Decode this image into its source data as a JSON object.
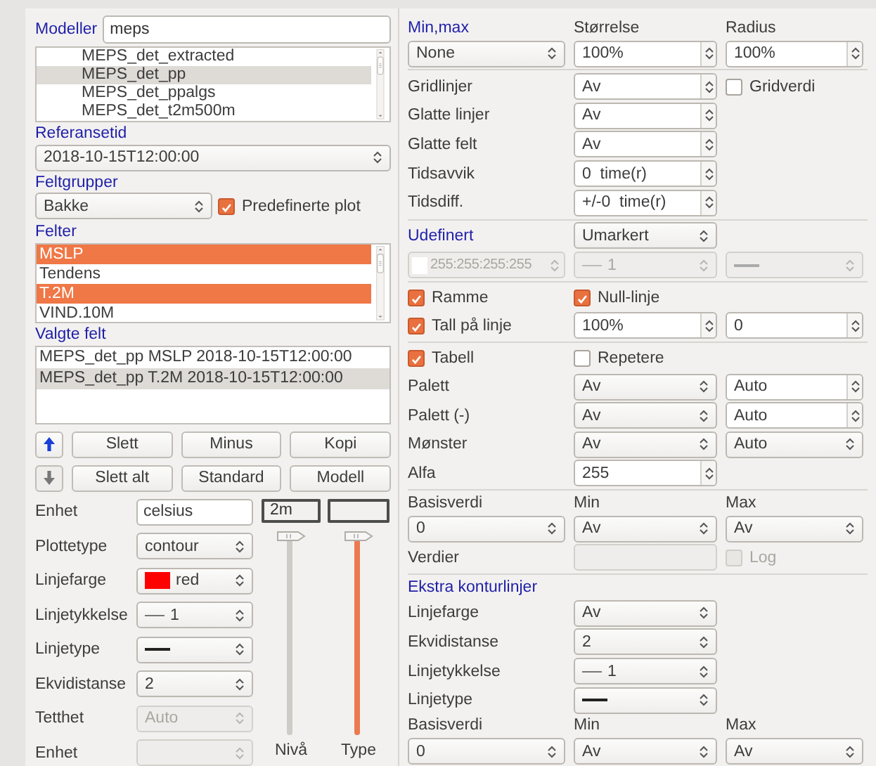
{
  "models": {
    "label": "Modeller",
    "search": "meps",
    "active": false,
    "items": [
      {
        "text": "MEPS_det_extracted",
        "selected": false
      },
      {
        "text": "MEPS_det_pp",
        "selected": true
      },
      {
        "text": "MEPS_det_ppalgs",
        "selected": false
      },
      {
        "text": "MEPS_det_t2m500m",
        "selected": false
      }
    ]
  },
  "reference_time": {
    "label": "Referansetid",
    "value": "2018-10-15T12:00:00"
  },
  "field_groups": {
    "label": "Feltgrupper",
    "value": "Bakke",
    "predefined": {
      "text": "Predefinerte plot",
      "checked": true
    }
  },
  "fields": {
    "label": "Felter",
    "active": true,
    "items": [
      {
        "text": "MSLP",
        "selected": true
      },
      {
        "text": "Tendens",
        "selected": false
      },
      {
        "text": "T.2M",
        "selected": true
      },
      {
        "text": "VIND.10M",
        "selected": false
      }
    ]
  },
  "selected_fields": {
    "label": "Valgte felt",
    "active": false,
    "items": [
      {
        "text": "MEPS_det_pp MSLP 2018-10-15T12:00:00",
        "selected": false
      },
      {
        "text": "MEPS_det_pp T.2M 2018-10-15T12:00:00",
        "selected": true
      }
    ]
  },
  "buttons": [
    [
      {
        "kind": "arrow-up",
        "disabled": false
      },
      {
        "kind": "text",
        "label": "Slett",
        "disabled": false
      },
      {
        "kind": "text",
        "label": "Minus",
        "disabled": false
      },
      {
        "kind": "text",
        "label": "Kopi",
        "disabled": false
      }
    ],
    [
      {
        "kind": "arrow-down",
        "disabled": true
      },
      {
        "kind": "text",
        "label": "Slett alt",
        "disabled": false
      },
      {
        "kind": "text",
        "label": "Standard",
        "disabled": false
      },
      {
        "kind": "text",
        "label": "Modell",
        "disabled": false
      }
    ]
  ],
  "plot_options": [
    {
      "label": "Enhet",
      "kind": "field",
      "value": "celsius",
      "disabled": false
    },
    {
      "label": "Plottetype",
      "kind": "combo",
      "value": "contour",
      "disabled": false
    },
    {
      "label": "Linjefarge",
      "kind": "color",
      "value": "red",
      "color": "#ff0000",
      "disabled": false
    },
    {
      "label": "Linjetykkelse",
      "kind": "linewidth",
      "value": "1",
      "disabled": false
    },
    {
      "label": "Linjetype",
      "kind": "linetype",
      "disabled": false
    },
    {
      "label": "Ekvidistanse",
      "kind": "combo",
      "value": "2",
      "disabled": false
    },
    {
      "label": "Tetthet",
      "kind": "combo",
      "value": "Auto",
      "disabled": true
    },
    {
      "label": "Enhet",
      "kind": "combo",
      "disabled": true
    }
  ],
  "sliders": [
    {
      "label": "Nivå",
      "value": "2m",
      "level": 1,
      "disabled": true
    },
    {
      "label": "Type",
      "level": 1,
      "disabled": false
    }
  ],
  "options": [
    {
      "kind": "header",
      "cells": [
        {
          "kind": "heading",
          "text": "Min,max"
        },
        {
          "kind": "label",
          "text": "Størrelse"
        },
        {
          "kind": "label",
          "text": "Radius"
        }
      ]
    },
    {
      "kind": "controls",
      "cells": [
        {
          "kind": "combo",
          "value": "None",
          "disabled": false
        },
        {
          "kind": "spin",
          "value": "100%",
          "disabled": false
        },
        {
          "kind": "spin",
          "value": "100%",
          "disabled": false
        }
      ]
    },
    {
      "kind": "separator"
    },
    {
      "kind": "controls",
      "cells": [
        {
          "kind": "label",
          "text": "Gridlinjer"
        },
        {
          "kind": "spin",
          "value": "Av",
          "disabled": false
        },
        {
          "kind": "check",
          "text": "Gridverdi",
          "checked": false,
          "disabled": false
        }
      ]
    },
    {
      "kind": "controls",
      "cells": [
        {
          "kind": "label",
          "text": "Glatte linjer"
        },
        {
          "kind": "spin",
          "value": "Av",
          "disabled": false
        }
      ]
    },
    {
      "kind": "controls",
      "cells": [
        {
          "kind": "label",
          "text": "Glatte felt"
        },
        {
          "kind": "spin",
          "value": "Av",
          "disabled": false
        }
      ]
    },
    {
      "kind": "controls",
      "cells": [
        {
          "kind": "label",
          "text": "Tidsavvik"
        },
        {
          "kind": "spin",
          "value": "0  time(r)",
          "disabled": false
        }
      ]
    },
    {
      "kind": "controls",
      "cells": [
        {
          "kind": "label",
          "text": "Tidsdiff."
        },
        {
          "kind": "spin",
          "value": "+/-0  time(r)",
          "disabled": false
        }
      ]
    },
    {
      "kind": "separator"
    },
    {
      "kind": "controls",
      "cells": [
        {
          "kind": "heading",
          "text": "Udefinert"
        },
        {
          "kind": "combo",
          "value": "Umarkert",
          "disabled": false
        }
      ]
    },
    {
      "kind": "controls",
      "cells": [
        {
          "kind": "color",
          "value": "255:255:255:255",
          "color": "#ffffff",
          "disabled": true
        },
        {
          "kind": "linewidth",
          "value": "1",
          "disabled": true
        },
        {
          "kind": "linetype",
          "disabled": true
        }
      ]
    },
    {
      "kind": "separator"
    },
    {
      "kind": "checks",
      "cells": [
        {
          "kind": "check",
          "text": "Ramme",
          "checked": true,
          "disabled": false
        },
        {
          "kind": "check",
          "text": "Null-linje",
          "checked": true,
          "disabled": false
        }
      ]
    },
    {
      "kind": "controls",
      "cells": [
        {
          "kind": "check",
          "text": "Tall på linje",
          "checked": true,
          "disabled": false
        },
        {
          "kind": "spin",
          "value": "100%",
          "disabled": false
        },
        {
          "kind": "spin",
          "value": "0",
          "disabled": false
        }
      ]
    },
    {
      "kind": "separator"
    },
    {
      "kind": "checks",
      "cells": [
        {
          "kind": "check",
          "text": "Tabell",
          "checked": true,
          "disabled": false
        },
        {
          "kind": "check",
          "text": "Repetere",
          "checked": false,
          "disabled": false
        }
      ]
    },
    {
      "kind": "controls",
      "cells": [
        {
          "kind": "label",
          "text": "Palett"
        },
        {
          "kind": "combo",
          "value": "Av",
          "disabled": false
        },
        {
          "kind": "spin",
          "value": "Auto",
          "disabled": false
        }
      ]
    },
    {
      "kind": "controls",
      "cells": [
        {
          "kind": "label",
          "text": "Palett (-)"
        },
        {
          "kind": "combo",
          "value": "Av",
          "disabled": false
        },
        {
          "kind": "spin",
          "value": "Auto",
          "disabled": false
        }
      ]
    },
    {
      "kind": "controls",
      "cells": [
        {
          "kind": "label",
          "text": "Mønster"
        },
        {
          "kind": "combo",
          "value": "Av",
          "disabled": false
        },
        {
          "kind": "combo",
          "value": "Auto",
          "disabled": false
        }
      ]
    },
    {
      "kind": "controls",
      "cells": [
        {
          "kind": "label",
          "text": "Alfa"
        },
        {
          "kind": "spin",
          "value": "255",
          "disabled": false
        }
      ]
    },
    {
      "kind": "separator"
    },
    {
      "kind": "header",
      "cells": [
        {
          "kind": "label",
          "text": "Basisverdi"
        },
        {
          "kind": "label",
          "text": "Min"
        },
        {
          "kind": "label",
          "text": "Max"
        }
      ]
    },
    {
      "kind": "controls",
      "cells": [
        {
          "kind": "combo",
          "value": "0",
          "disabled": false
        },
        {
          "kind": "combo",
          "value": "Av",
          "disabled": false
        },
        {
          "kind": "combo",
          "value": "Av",
          "disabled": false
        }
      ]
    },
    {
      "kind": "controls",
      "cells": [
        {
          "kind": "label",
          "text": "Verdier"
        },
        {
          "kind": "field",
          "disabled": true
        },
        {
          "kind": "check",
          "text": "Log",
          "checked": false,
          "disabled": true
        }
      ]
    },
    {
      "kind": "separator"
    },
    {
      "kind": "header",
      "cells": [
        {
          "kind": "heading",
          "text": "Ekstra konturlinjer"
        }
      ]
    },
    {
      "kind": "controls",
      "cells": [
        {
          "kind": "label",
          "text": "Linjefarge"
        },
        {
          "kind": "combo",
          "value": "Av",
          "disabled": false
        }
      ]
    },
    {
      "kind": "controls",
      "cells": [
        {
          "kind": "label",
          "text": "Ekvidistanse"
        },
        {
          "kind": "combo",
          "value": "2",
          "disabled": false
        }
      ]
    },
    {
      "kind": "controls",
      "cells": [
        {
          "kind": "label",
          "text": "Linjetykkelse"
        },
        {
          "kind": "linewidth",
          "value": "1",
          "disabled": false
        }
      ]
    },
    {
      "kind": "controls",
      "cells": [
        {
          "kind": "label",
          "text": "Linjetype"
        },
        {
          "kind": "linetype",
          "disabled": false
        }
      ]
    },
    {
      "kind": "header",
      "cells": [
        {
          "kind": "label",
          "text": "Basisverdi"
        },
        {
          "kind": "label",
          "text": "Min"
        },
        {
          "kind": "label",
          "text": "Max"
        }
      ]
    },
    {
      "kind": "controls",
      "cells": [
        {
          "kind": "combo",
          "value": "0",
          "disabled": false
        },
        {
          "kind": "combo",
          "value": "Av",
          "disabled": false
        },
        {
          "kind": "combo",
          "value": "Av",
          "disabled": false
        }
      ]
    }
  ]
}
